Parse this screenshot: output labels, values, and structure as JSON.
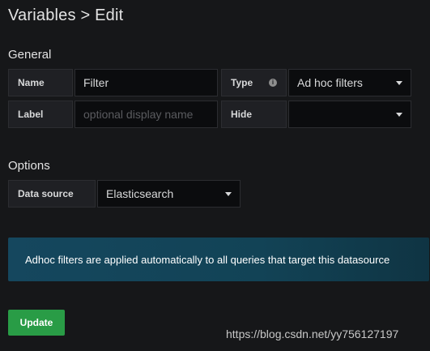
{
  "page": {
    "title": "Variables > Edit"
  },
  "general": {
    "section_title": "General",
    "name_label": "Name",
    "name_value": "Filter",
    "type_label": "Type",
    "type_info_icon": "info-icon",
    "type_value": "Ad hoc filters",
    "label_label": "Label",
    "label_placeholder": "optional display name",
    "hide_label": "Hide",
    "hide_value": ""
  },
  "options": {
    "section_title": "Options",
    "datasource_label": "Data source",
    "datasource_value": "Elasticsearch"
  },
  "alert": {
    "text": "Adhoc filters are applied automatically to all queries that target this datasource"
  },
  "actions": {
    "update_label": "Update"
  },
  "watermark": {
    "text": "https://blog.csdn.net/yy756127197"
  },
  "colors": {
    "background": "#161719",
    "button_green": "#299c46",
    "alert_blue": "#15475e"
  }
}
